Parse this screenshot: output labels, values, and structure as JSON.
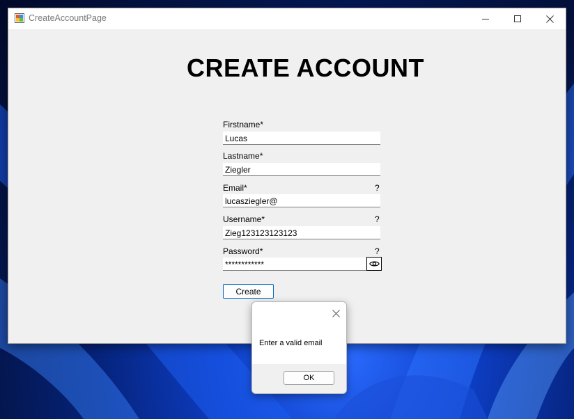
{
  "window": {
    "title": "CreateAccountPage",
    "min_icon": "minimize-icon",
    "max_icon": "maximize-icon",
    "close_icon": "close-icon"
  },
  "page": {
    "heading": "CREATE ACCOUNT"
  },
  "form": {
    "firstname": {
      "label": "Firstname*",
      "value": "Lucas"
    },
    "lastname": {
      "label": "Lastname*",
      "value": "Ziegler"
    },
    "email": {
      "label": "Email*",
      "value": "lucasziegler@",
      "help": "?"
    },
    "username": {
      "label": "Username*",
      "value": "Zieg123123123123",
      "help": "?"
    },
    "password": {
      "label": "Password*",
      "value": "************",
      "help": "?",
      "toggle_icon": "eye-icon"
    },
    "create_label": "Create"
  },
  "dialog": {
    "message": "Enter a valid email",
    "ok_label": "OK",
    "close_icon": "close-icon"
  },
  "colors": {
    "accent": "#0067c0",
    "window_bg": "#f0f0f0",
    "titlebar_bg": "#ffffff"
  }
}
